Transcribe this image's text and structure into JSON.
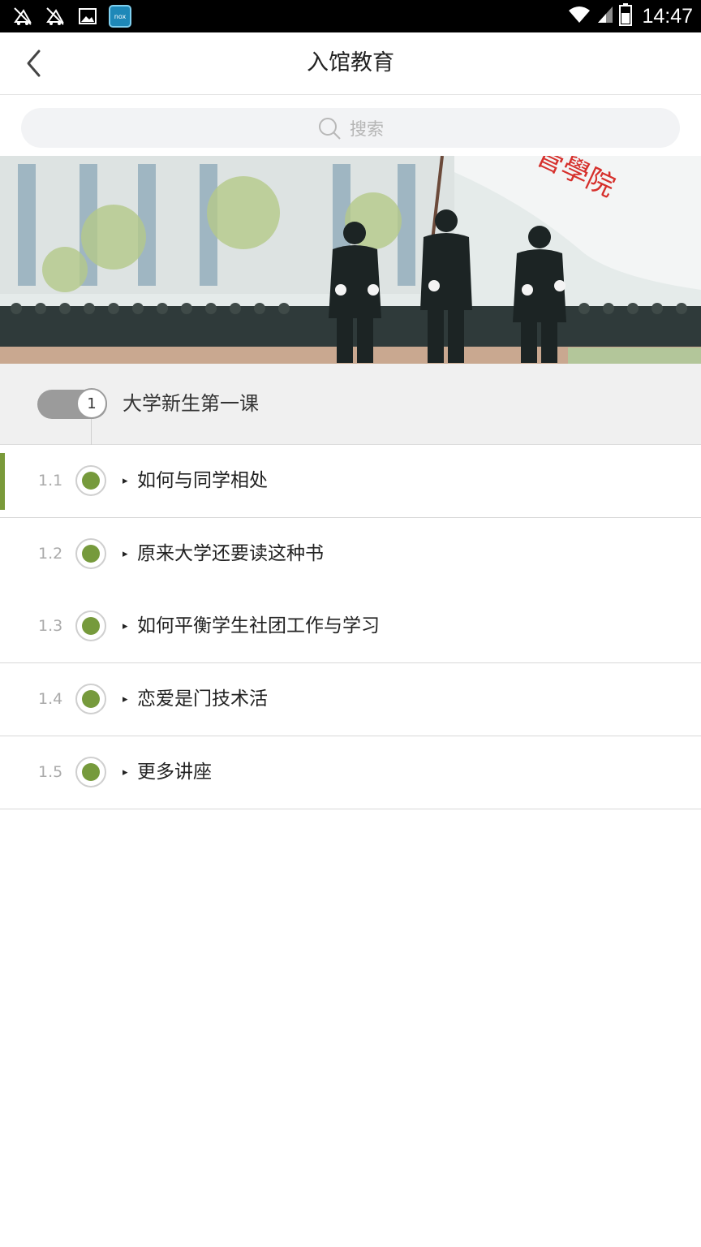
{
  "status_bar": {
    "time": "14:47",
    "left_icons": [
      "sync-off-icon",
      "sync-off-icon",
      "image-icon",
      "nox-app-icon"
    ],
    "nox_label": "nox",
    "right_icons": [
      "wifi-icon",
      "signal-icon",
      "battery-icon"
    ]
  },
  "header": {
    "title": "入馆教育",
    "back_icon": "chevron-left-icon"
  },
  "search": {
    "placeholder": "搜索",
    "icon": "search-icon"
  },
  "banner": {
    "flag_text": "管學院"
  },
  "chapter": {
    "number": "1",
    "title": "大学新生第一课"
  },
  "lessons": [
    {
      "num": "1.1",
      "marker": "▸",
      "label": "如何与同学相处",
      "active": true
    },
    {
      "num": "1.2",
      "marker": "▸",
      "label": "原来大学还要读这种书",
      "active": false
    },
    {
      "num": "1.3",
      "marker": "▸",
      "label": "如何平衡学生社团工作与学习",
      "active": false
    },
    {
      "num": "1.4",
      "marker": "▸",
      "label": "恋爱是门技术活",
      "active": false
    },
    {
      "num": "1.5",
      "marker": "▸",
      "label": "更多讲座",
      "active": false
    }
  ],
  "colors": {
    "accent_green": "#769a3c",
    "status_bar": "#000000"
  }
}
